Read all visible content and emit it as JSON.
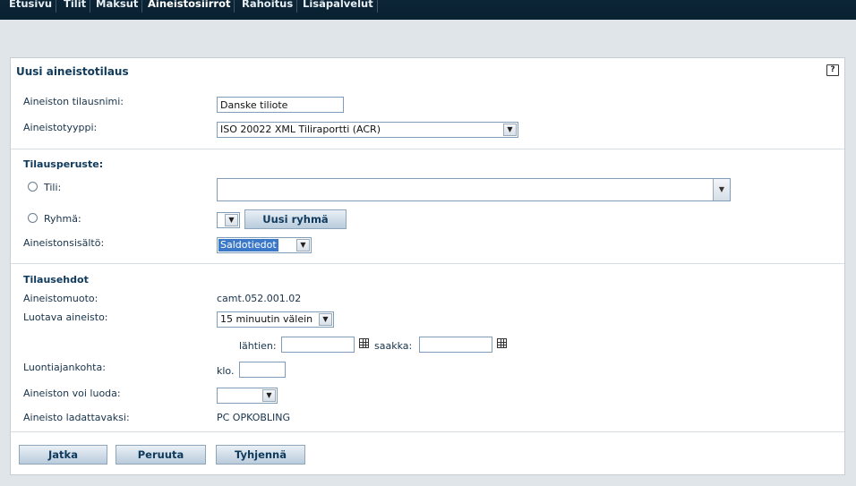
{
  "nav": {
    "items": [
      {
        "label": "Etusivu"
      },
      {
        "label": "Tilit"
      },
      {
        "label": "Maksut"
      },
      {
        "label": "Aineistosiirrot"
      },
      {
        "label": "Rahoitus"
      },
      {
        "label": "Lisäpalvelut"
      }
    ],
    "active_index": 3
  },
  "panel": {
    "title": "Uusi aineistotilaus",
    "help_icon_glyph": "?"
  },
  "form": {
    "order_name": {
      "label": "Aineiston tilausnimi:",
      "value": "Danske tiliote"
    },
    "material_type": {
      "label": "Aineistotyyppi:",
      "value": "ISO 20022 XML Tiliraportti (ACR)"
    },
    "basis": {
      "title": "Tilausperuste:",
      "account": {
        "label": "Tili:",
        "value": ""
      },
      "group": {
        "label": "Ryhmä:",
        "value": "",
        "new_group_button": "Uusi ryhmä"
      },
      "content": {
        "label": "Aineistonsisältö:",
        "value": "Saldotiedot"
      }
    },
    "terms": {
      "title": "Tilausehdot",
      "format": {
        "label": "Aineistomuoto:",
        "value": "camt.052.001.02"
      },
      "created": {
        "label": "Luotava aineisto:",
        "value": "15 minuutin välein"
      },
      "from_label": "lähtien:",
      "from_value": "",
      "to_label": "saakka:",
      "to_value": "",
      "time": {
        "label": "Luontiajankohta:",
        "prefix": "klo.",
        "value": ""
      },
      "can_create": {
        "label": "Aineiston voi luoda:",
        "value": ""
      },
      "downloadable": {
        "label": "Aineisto ladattavaksi:",
        "value": "PC OPKOBLING"
      }
    }
  },
  "buttons": {
    "continue": "Jatka",
    "cancel": "Peruuta",
    "clear": "Tyhjennä"
  },
  "icons": {
    "dropdown": "▼",
    "calendar": "calendar-icon"
  }
}
